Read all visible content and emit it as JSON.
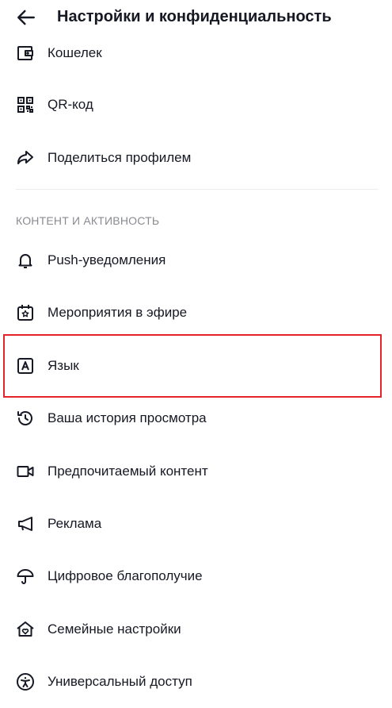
{
  "header": {
    "title": "Настройки и конфиденциальность",
    "back_icon": "arrow-left-icon"
  },
  "top_items": [
    {
      "label": "Кошелек",
      "icon": "wallet-icon"
    },
    {
      "label": "QR-код",
      "icon": "qr-code-icon"
    },
    {
      "label": "Поделиться профилем",
      "icon": "share-icon"
    }
  ],
  "section": {
    "title": "КОНТЕНТ И АКТИВНОСТЬ"
  },
  "content_items": [
    {
      "label": "Push-уведомления",
      "icon": "bell-icon"
    },
    {
      "label": "Мероприятия в эфире",
      "icon": "calendar-star-icon"
    },
    {
      "label": "Язык",
      "icon": "language-icon"
    },
    {
      "label": "Ваша история просмотра",
      "icon": "history-icon"
    },
    {
      "label": "Предпочитаемый контент",
      "icon": "video-camera-icon"
    },
    {
      "label": "Реклама",
      "icon": "megaphone-icon"
    },
    {
      "label": "Цифровое благополучие",
      "icon": "umbrella-icon"
    },
    {
      "label": "Семейные настройки",
      "icon": "family-home-icon"
    },
    {
      "label": "Универсальный доступ",
      "icon": "accessibility-icon"
    }
  ],
  "colors": {
    "highlight": "#e3242b",
    "text": "#161823",
    "secondary": "#8a8b91"
  }
}
